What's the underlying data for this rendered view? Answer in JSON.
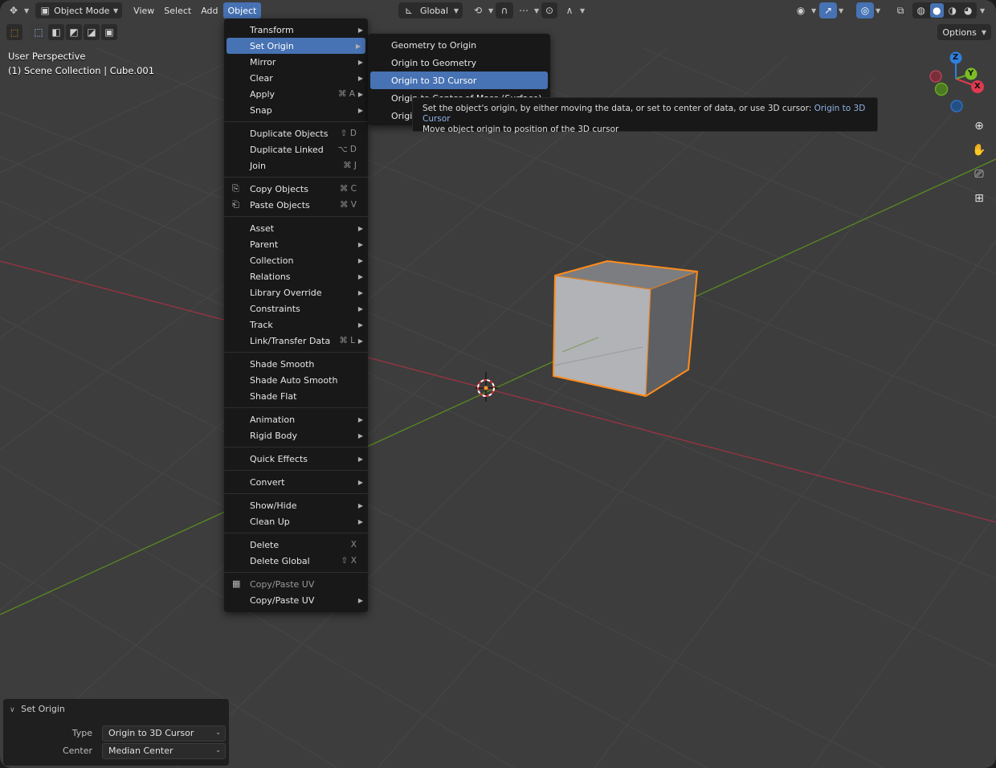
{
  "header": {
    "mode": "Object Mode",
    "menus": [
      "View",
      "Select",
      "Add",
      "Object"
    ],
    "active_menu": "Object",
    "transform_orientation": "Global",
    "options_label": "Options"
  },
  "overlay": {
    "view_name": "User Perspective",
    "collection_info": "(1) Scene Collection | Cube.001"
  },
  "object_menu": {
    "groups": [
      [
        {
          "label": "Transform",
          "submenu": true
        },
        {
          "label": "Set Origin",
          "submenu": true,
          "highlight": true
        },
        {
          "label": "Mirror",
          "submenu": true
        },
        {
          "label": "Clear",
          "submenu": true
        },
        {
          "label": "Apply",
          "shortcut": "⌘ A",
          "submenu": true
        },
        {
          "label": "Snap",
          "submenu": true
        }
      ],
      [
        {
          "label": "Duplicate Objects",
          "shortcut": "⇧ D"
        },
        {
          "label": "Duplicate Linked",
          "shortcut": "⌥ D"
        },
        {
          "label": "Join",
          "shortcut": "⌘ J"
        }
      ],
      [
        {
          "label": "Copy Objects",
          "shortcut": "⌘ C",
          "icon": "copy-icon"
        },
        {
          "label": "Paste Objects",
          "shortcut": "⌘ V",
          "icon": "paste-icon"
        }
      ],
      [
        {
          "label": "Asset",
          "submenu": true
        },
        {
          "label": "Parent",
          "submenu": true
        },
        {
          "label": "Collection",
          "submenu": true
        },
        {
          "label": "Relations",
          "submenu": true
        },
        {
          "label": "Library Override",
          "submenu": true
        },
        {
          "label": "Constraints",
          "submenu": true
        },
        {
          "label": "Track",
          "submenu": true
        },
        {
          "label": "Link/Transfer Data",
          "shortcut": "⌘ L",
          "submenu": true
        }
      ],
      [
        {
          "label": "Shade Smooth"
        },
        {
          "label": "Shade Auto Smooth"
        },
        {
          "label": "Shade Flat"
        }
      ],
      [
        {
          "label": "Animation",
          "submenu": true
        },
        {
          "label": "Rigid Body",
          "submenu": true
        }
      ],
      [
        {
          "label": "Quick Effects",
          "submenu": true
        }
      ],
      [
        {
          "label": "Convert",
          "submenu": true
        }
      ],
      [
        {
          "label": "Show/Hide",
          "submenu": true
        },
        {
          "label": "Clean Up",
          "submenu": true
        }
      ],
      [
        {
          "label": "Delete",
          "shortcut": "X"
        },
        {
          "label": "Delete Global",
          "shortcut": "⇧ X"
        }
      ],
      [
        {
          "label": "Copy/Paste UV",
          "disabled": true,
          "icon": "uv-icon"
        },
        {
          "label": "Copy/Paste UV",
          "submenu": true
        }
      ]
    ]
  },
  "set_origin_menu": {
    "items": [
      {
        "label": "Geometry to Origin"
      },
      {
        "label": "Origin to Geometry"
      },
      {
        "label": "Origin to 3D Cursor",
        "highlight": true
      },
      {
        "label": "Origin to Center of Mass (Surface)"
      },
      {
        "label": "Origin to Center of Mass (Volume)"
      }
    ]
  },
  "tooltip": {
    "description": "Set the object's origin, by either moving the data, or set to center of data, or use 3D cursor:",
    "operator": "Origin to 3D Cursor",
    "detail": "Move object origin to position of the 3D cursor"
  },
  "operator_panel": {
    "title": "Set Origin",
    "type_label": "Type",
    "type_value": "Origin to 3D Cursor",
    "center_label": "Center",
    "center_value": "Median Center"
  },
  "gizmo": {
    "x": "X",
    "y": "Y",
    "z": "Z"
  },
  "colors": {
    "accent": "#4772b3",
    "x_axis": "#ff3352",
    "y_axis": "#8bdc00",
    "z_axis": "#2890ff",
    "selection": "#ff8c1a"
  }
}
